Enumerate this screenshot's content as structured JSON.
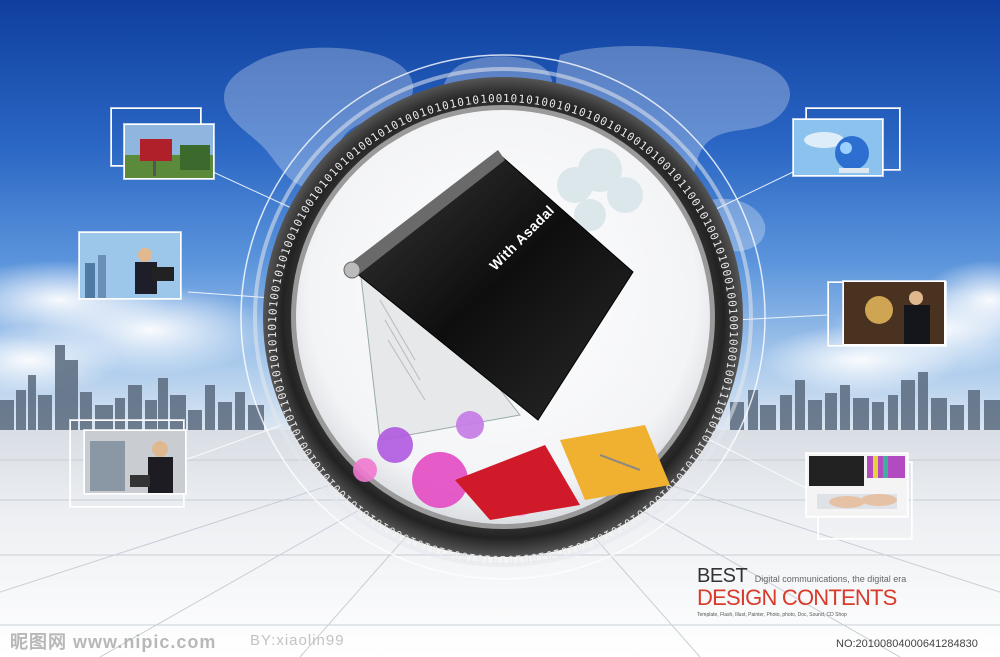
{
  "colors": {
    "sky_top": "#0f3f9e",
    "accent_red": "#d83b2a",
    "ring_dark": "#2b2b2b",
    "laptop": "#1a1a1a"
  },
  "laptop_label": "With Asadal",
  "ring_binary": "10101001010100101001010010110010100101000100100100010011101010101010101001010101010010101001010101001101010001010101001010100101011001010101010100101010010100101010101001010100101010101001001001010",
  "brand": {
    "best": "BEST",
    "best_sub": "Digital communications, the digital era",
    "design": "DESIGN CONTENTS",
    "tiny": "Template, Flash, Illust, Painter, Photo, photo, Doc, Sound, CD Shop"
  },
  "watermark": {
    "left": "昵图网 www.nipic.com",
    "mid": "BY:xiaolin99",
    "right": "NO:20100804000641284830"
  },
  "thumbnails": [
    {
      "name": "mailbox-photo",
      "icon": "mailbox-icon"
    },
    {
      "name": "businessman-laptop-photo",
      "icon": "person-icon"
    },
    {
      "name": "office-worker-photo",
      "icon": "person-icon"
    },
    {
      "name": "globe-puzzle-photo",
      "icon": "globe-icon"
    },
    {
      "name": "presenter-photo",
      "icon": "person-icon"
    },
    {
      "name": "typing-hands-photo",
      "icon": "keyboard-icon"
    }
  ]
}
